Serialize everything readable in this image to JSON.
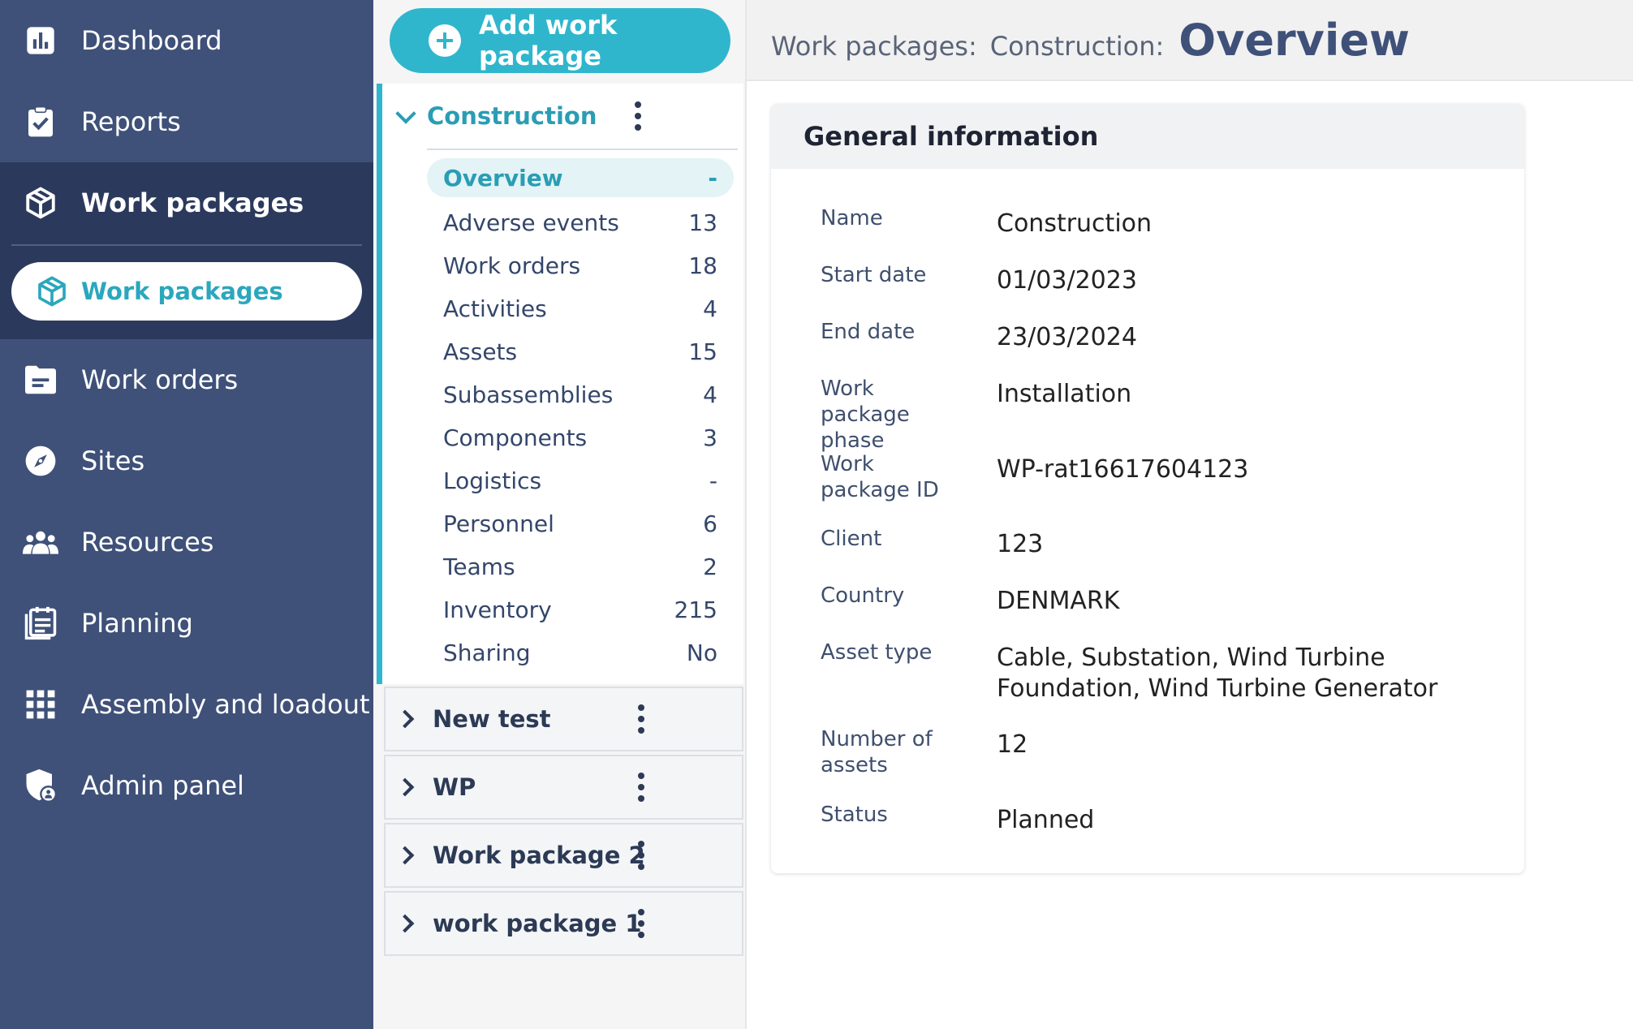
{
  "sidebar": {
    "items": [
      {
        "label": "Dashboard",
        "icon": "bar-chart-icon"
      },
      {
        "label": "Reports",
        "icon": "clipboard-check-icon"
      },
      {
        "label": "Work packages",
        "icon": "package-icon"
      },
      {
        "label": "Work packages",
        "icon": "package-icon"
      },
      {
        "label": "Work orders",
        "icon": "folder-icon"
      },
      {
        "label": "Sites",
        "icon": "compass-icon"
      },
      {
        "label": "Resources",
        "icon": "people-icon"
      },
      {
        "label": "Planning",
        "icon": "calendar-list-icon"
      },
      {
        "label": "Assembly and loadout",
        "icon": "grid-icon"
      },
      {
        "label": "Admin panel",
        "icon": "shield-user-icon"
      }
    ]
  },
  "workpanel": {
    "add_button": "Add work package",
    "open_package": {
      "title": "Construction",
      "subitems": [
        {
          "label": "Overview",
          "count": "-"
        },
        {
          "label": "Adverse events",
          "count": "13"
        },
        {
          "label": "Work orders",
          "count": "18"
        },
        {
          "label": "Activities",
          "count": "4"
        },
        {
          "label": "Assets",
          "count": "15"
        },
        {
          "label": "Subassemblies",
          "count": "4"
        },
        {
          "label": "Components",
          "count": "3"
        },
        {
          "label": "Logistics",
          "count": "-"
        },
        {
          "label": "Personnel",
          "count": "6"
        },
        {
          "label": "Teams",
          "count": "2"
        },
        {
          "label": "Inventory",
          "count": "215"
        },
        {
          "label": "Sharing",
          "count": "No"
        }
      ]
    },
    "closed_packages": [
      "New test",
      "WP",
      "Work package 2",
      "work package 1"
    ]
  },
  "header": {
    "crumb1": "Work packages:",
    "crumb2": "Construction:",
    "title": "Overview"
  },
  "card": {
    "title": "General information",
    "rows": [
      {
        "label": "Name",
        "value": "Construction"
      },
      {
        "label": "Start date",
        "value": "01/03/2023"
      },
      {
        "label": "End date",
        "value": "23/03/2024"
      },
      {
        "label": "Work package phase",
        "value": "Installation"
      },
      {
        "label": "Work package ID",
        "value": "WP-rat16617604123"
      },
      {
        "label": "Client",
        "value": "123"
      },
      {
        "label": "Country",
        "value": "DENMARK"
      },
      {
        "label": "Asset type",
        "value": "Cable, Substation, Wind Turbine Foundation, Wind Turbine Generator"
      },
      {
        "label": "Number of assets",
        "value": "12"
      },
      {
        "label": "Status",
        "value": "Planned"
      }
    ]
  },
  "colors": {
    "sidebar_bg": "#3f5179",
    "sidebar_active_bg": "#2b3a5c",
    "accent": "#2fb6cd",
    "title_color": "#3f5179"
  }
}
